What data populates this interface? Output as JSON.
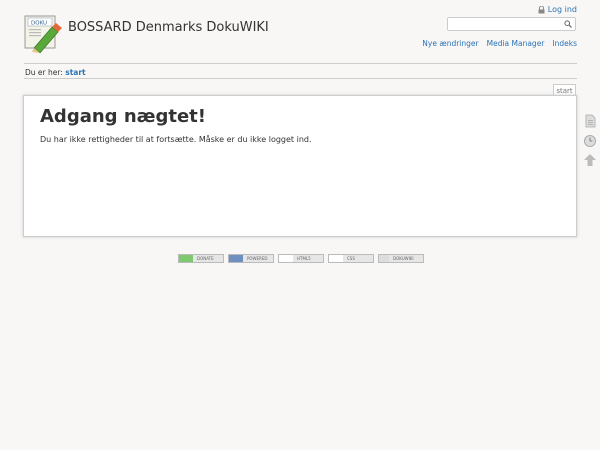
{
  "header": {
    "site_title": "BOSSARD Denmarks DokuWIKI",
    "login_label": "Log ind",
    "search_placeholder": "",
    "nav": [
      "Nye ændringer",
      "Media Manager",
      "Indeks"
    ]
  },
  "breadcrumb": {
    "prefix": "Du er her:",
    "link": "start"
  },
  "page_tab": "start",
  "content": {
    "heading": "Adgang nægtet!",
    "message": "Du har ikke rettigheder til at fortsætte. Måske er du ikke logget ind."
  },
  "tools": [
    "page-icon",
    "revisions-icon",
    "back-to-top-icon"
  ],
  "footer_badges": [
    {
      "name": "donate-badge",
      "lead_color": "#7ec86f",
      "text": "DONATE"
    },
    {
      "name": "php-badge",
      "lead_color": "#6f8fc0",
      "text": "POWERED"
    },
    {
      "name": "w3c-html-badge",
      "lead_color": "#ffffff",
      "text": "HTML5"
    },
    {
      "name": "w3c-css-badge",
      "lead_color": "#ffffff",
      "text": "CSS"
    },
    {
      "name": "dokuwiki-badge",
      "lead_color": "#dddddd",
      "text": "DOKUWIKI"
    }
  ]
}
